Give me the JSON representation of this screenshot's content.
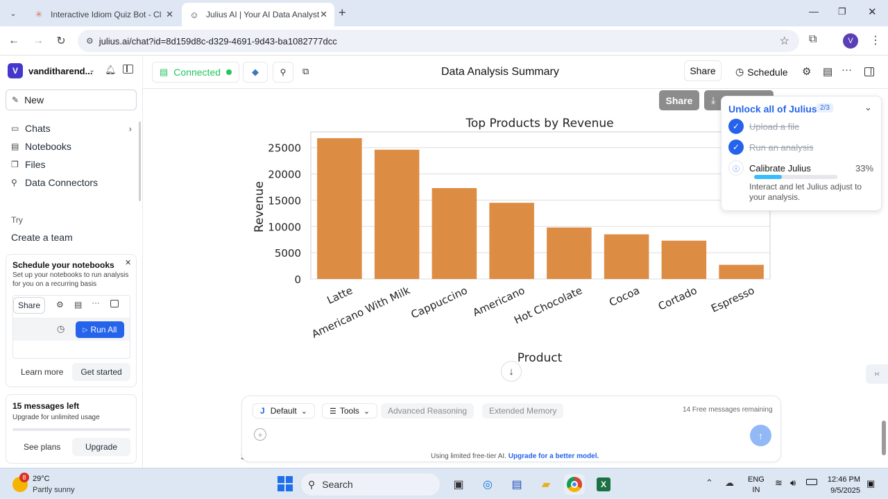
{
  "browser": {
    "tabs": [
      {
        "title": "Interactive Idiom Quiz Bot - Cla",
        "active": false
      },
      {
        "title": "Julius AI | Your AI Data Analyst",
        "active": true
      }
    ],
    "url": "julius.ai/chat?id=8d159d8c-d329-4691-9d43-ba1082777dcc",
    "profile_initial": "V"
  },
  "sidebar": {
    "user": "vanditharend...",
    "user_initial": "V",
    "new_label": "New",
    "nav": [
      {
        "label": "Chats"
      },
      {
        "label": "Notebooks"
      },
      {
        "label": "Files"
      },
      {
        "label": "Data Connectors"
      }
    ],
    "try_label": "Try",
    "create_team": "Create a team",
    "notebook_card": {
      "title": "Schedule your notebooks",
      "desc": "Set up your notebooks to run analysis for you on a recurring basis",
      "share": "Share",
      "run_all": "Run All",
      "learn_more": "Learn more",
      "get_started": "Get started"
    },
    "messages_card": {
      "title": "15 messages left",
      "desc": "Upgrade for unlimited usage",
      "see_plans": "See plans",
      "upgrade": "Upgrade"
    }
  },
  "header": {
    "connected": "Connected",
    "title": "Data Analysis Summary",
    "share": "Share",
    "schedule": "Schedule"
  },
  "chart_toolbar": {
    "share": "Share"
  },
  "chart_data": {
    "type": "bar",
    "title": "Top Products by Revenue",
    "xlabel": "Product",
    "ylabel": "Revenue",
    "categories": [
      "Latte",
      "Americano With Milk",
      "Cappuccino",
      "Americano",
      "Hot Chocolate",
      "Cocoa",
      "Cortado",
      "Espresso"
    ],
    "values": [
      26800,
      24600,
      17300,
      14500,
      9800,
      8500,
      7300,
      2700
    ],
    "ylim": [
      0,
      28000
    ],
    "yticks": [
      "0",
      "5000",
      "10000",
      "15000",
      "20000",
      "25000"
    ],
    "grid": true,
    "color": "#dd8c44"
  },
  "onboarding": {
    "title": "Unlock all of Julius",
    "progress": "2/3",
    "steps": [
      {
        "label": "Upload a file",
        "done": true
      },
      {
        "label": "Run an analysis",
        "done": true
      }
    ],
    "current": {
      "label": "Calibrate Julius",
      "percent": "33%",
      "fraction": 0.33,
      "desc": "Interact and let Julius adjust to your analysis."
    }
  },
  "composer": {
    "model": "Default",
    "model_initial": "J",
    "tools": "Tools",
    "advanced": "Advanced Reasoning",
    "memory": "Extended Memory",
    "free_count": "14",
    "free_label": "Free messages remaining",
    "footer_text": "Using limited free-tier AI.",
    "footer_link": "Upgrade for a better model."
  },
  "taskbar": {
    "badge": "8",
    "temp": "29°C",
    "weather": "Partly sunny",
    "search": "Search",
    "lang1": "ENG",
    "lang2": "IN",
    "time": "12:46 PM",
    "date": "9/5/2025"
  },
  "colors": {
    "accent": "#2563eb",
    "connected": "#22c55e",
    "bar": "#dd8c44"
  }
}
